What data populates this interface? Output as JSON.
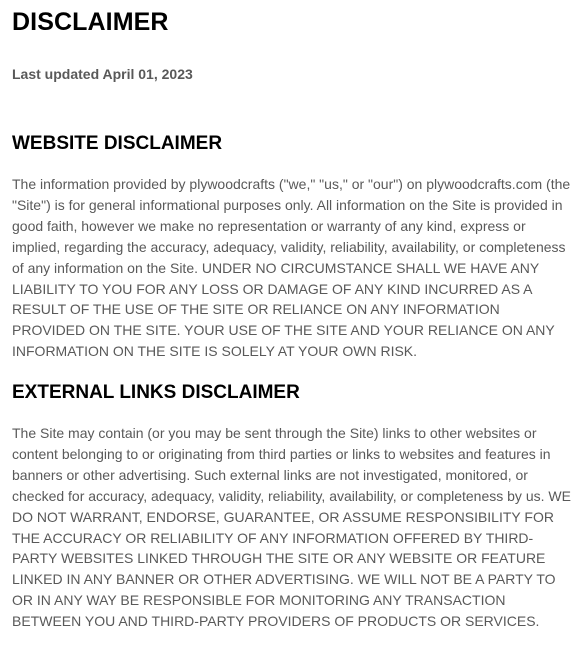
{
  "document": {
    "title": "DISCLAIMER",
    "last_updated": "Last updated April 01, 2023"
  },
  "sections": [
    {
      "heading": "WEBSITE DISCLAIMER",
      "lines": [
        "The information provided by plywoodcrafts (\"we,\" \"us,\" or \"our\") on plywoodcrafts.com (the",
        "\"Site\") is for general informational purposes only. All information on the Site is provided in",
        "good faith, however we make no representation or warranty of any kind, express or",
        "implied, regarding the accuracy, adequacy, validity, reliability, availability, or completeness",
        "of any information on the Site. UNDER NO CIRCUMSTANCE SHALL WE HAVE ANY",
        "LIABILITY TO YOU FOR ANY LOSS OR DAMAGE OF ANY KIND INCURRED AS A",
        "RESULT OF THE USE OF THE SITE OR RELIANCE ON ANY INFORMATION",
        "PROVIDED ON THE SITE. YOUR USE OF THE SITE AND YOUR RELIANCE ON ANY",
        "INFORMATION ON THE SITE IS SOLELY AT YOUR OWN RISK."
      ]
    },
    {
      "heading": "EXTERNAL LINKS DISCLAIMER",
      "lines": [
        "The Site may contain (or you may be sent through the Site) links to other websites or",
        "content belonging to or originating from third parties or links to websites and features in",
        "banners or other advertising. Such external links are not investigated, monitored, or",
        "checked for accuracy, adequacy, validity, reliability, availability, or completeness by us. WE",
        "DO NOT WARRANT, ENDORSE, GUARANTEE, OR ASSUME RESPONSIBILITY FOR",
        "THE ACCURACY OR RELIABILITY OF ANY INFORMATION OFFERED BY THIRD-",
        "PARTY WEBSITES LINKED THROUGH THE SITE OR ANY WEBSITE OR FEATURE",
        "LINKED IN ANY BANNER OR OTHER ADVERTISING. WE WILL NOT BE A PARTY TO",
        "OR IN ANY WAY BE RESPONSIBLE FOR MONITORING ANY TRANSACTION",
        "BETWEEN YOU AND THIRD-PARTY PROVIDERS OF PRODUCTS OR SERVICES."
      ]
    }
  ]
}
